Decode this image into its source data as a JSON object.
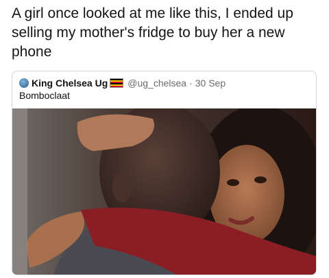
{
  "caption": "A girl once looked at me like this, I ended up selling my mother's fridge to buy her a new phone",
  "tweet": {
    "display_name": "King Chelsea Ug",
    "handle": "@ug_chelsea",
    "separator": "·",
    "date": "30 Sep",
    "text": "Bomboclaat",
    "flag_colors": [
      "#000000",
      "#f5cc00",
      "#d21034",
      "#000000",
      "#f5cc00",
      "#d21034"
    ]
  },
  "photo": {
    "alt_name": "couple-embrace-photo"
  }
}
